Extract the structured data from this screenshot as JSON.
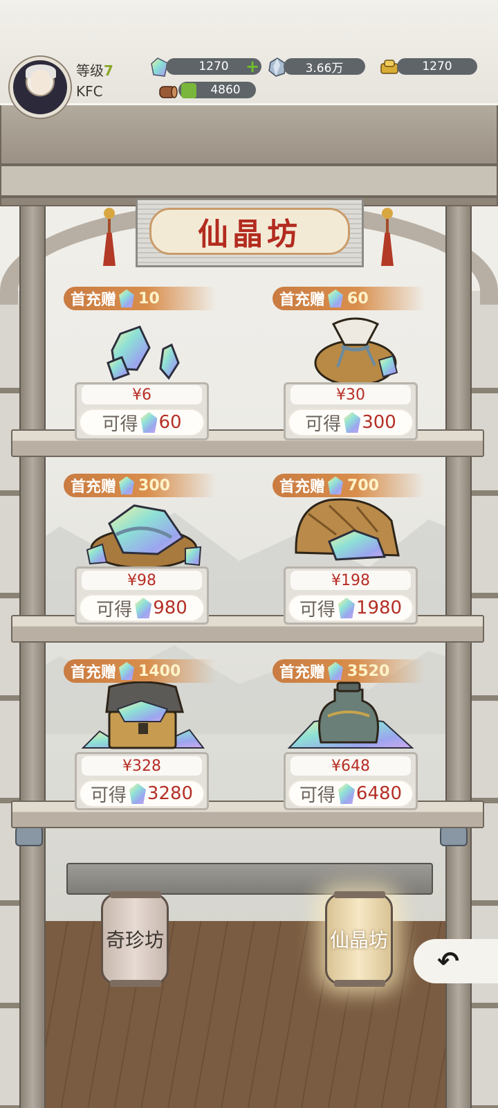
{
  "player": {
    "level_label": "等级",
    "level": "7",
    "name": "KFC"
  },
  "resources": {
    "crystal": "1270",
    "ore": "3.66万",
    "gold": "1270",
    "wood": "4860"
  },
  "shop": {
    "title": "仙晶坊",
    "items": [
      {
        "bonus_label": "首充赠",
        "bonus": "10",
        "price": "¥6",
        "get_label": "可得",
        "amount": "60"
      },
      {
        "bonus_label": "首充赠",
        "bonus": "60",
        "price": "¥30",
        "get_label": "可得",
        "amount": "300"
      },
      {
        "bonus_label": "首充赠",
        "bonus": "300",
        "price": "¥98",
        "get_label": "可得",
        "amount": "980"
      },
      {
        "bonus_label": "首充赠",
        "bonus": "700",
        "price": "¥198",
        "get_label": "可得",
        "amount": "1980"
      },
      {
        "bonus_label": "首充赠",
        "bonus": "1400",
        "price": "¥328",
        "get_label": "可得",
        "amount": "3280"
      },
      {
        "bonus_label": "首充赠",
        "bonus": "3520",
        "price": "¥648",
        "get_label": "可得",
        "amount": "6480"
      }
    ]
  },
  "tabs": {
    "treasure": "奇珍坊",
    "crystal": "仙晶坊"
  },
  "back": "↶",
  "colors": {
    "price_red": "#b62e26",
    "title_red": "#b32b1f",
    "bonus_orange": "#d98e4c",
    "level_green": "#8aa72a"
  }
}
